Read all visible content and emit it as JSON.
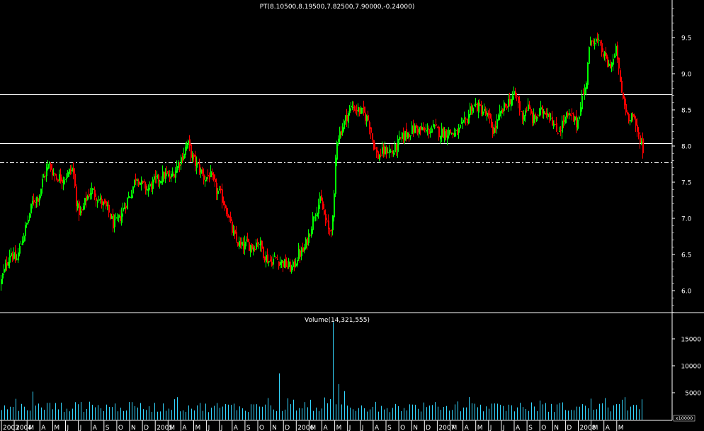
{
  "price_panel": {
    "title": "PT(8.10500,8.19500,7.82500,7.90000,-0.24000)"
  },
  "volume_panel": {
    "title": "Volume(14,321,555)",
    "multiplier": "x10000"
  },
  "colors": {
    "background": "#000000",
    "up_candle": "#00ff00",
    "down_candle": "#ff0000",
    "volume_bar": "#33d6ff",
    "grid_line": "#ffffff",
    "text": "#ffffff"
  },
  "chart_data": [
    {
      "type": "candlestick",
      "title": "PT(8.10500,8.19500,7.82500,7.90000,-0.24000)",
      "ylim": [
        5.6,
        10.0
      ],
      "y_ticks": [
        "9.5",
        "9.0",
        "8.5",
        "8.0",
        "7.5",
        "7.0",
        "6.5",
        "6.0"
      ],
      "horizontal_lines": [
        {
          "value": 8.72,
          "style": "solid"
        },
        {
          "value": 8.04,
          "style": "solid"
        },
        {
          "value": 7.77,
          "style": "dash-dot"
        }
      ],
      "last": {
        "open": 8.105,
        "high": 8.195,
        "low": 7.825,
        "close": 7.9,
        "change": -0.24
      },
      "price_path": [
        [
          0,
          6.1
        ],
        [
          6,
          6.3
        ],
        [
          14,
          6.55
        ],
        [
          22,
          6.4
        ],
        [
          30,
          6.7
        ],
        [
          38,
          6.95
        ],
        [
          46,
          7.25
        ],
        [
          54,
          7.3
        ],
        [
          60,
          7.55
        ],
        [
          68,
          7.75
        ],
        [
          76,
          7.6
        ],
        [
          86,
          7.55
        ],
        [
          94,
          7.6
        ],
        [
          102,
          7.7
        ],
        [
          108,
          7.15
        ],
        [
          114,
          7.05
        ],
        [
          120,
          7.25
        ],
        [
          128,
          7.4
        ],
        [
          136,
          7.3
        ],
        [
          144,
          7.2
        ],
        [
          152,
          7.1
        ],
        [
          160,
          6.9
        ],
        [
          168,
          7.0
        ],
        [
          176,
          7.2
        ],
        [
          184,
          7.35
        ],
        [
          192,
          7.6
        ],
        [
          200,
          7.45
        ],
        [
          208,
          7.4
        ],
        [
          216,
          7.5
        ],
        [
          224,
          7.55
        ],
        [
          232,
          7.6
        ],
        [
          240,
          7.55
        ],
        [
          248,
          7.7
        ],
        [
          256,
          7.85
        ],
        [
          264,
          8.05
        ],
        [
          272,
          7.8
        ],
        [
          280,
          7.7
        ],
        [
          288,
          7.55
        ],
        [
          296,
          7.6
        ],
        [
          304,
          7.4
        ],
        [
          312,
          7.3
        ],
        [
          320,
          7.1
        ],
        [
          326,
          6.85
        ],
        [
          332,
          6.7
        ],
        [
          340,
          6.6
        ],
        [
          348,
          6.65
        ],
        [
          356,
          6.6
        ],
        [
          364,
          6.7
        ],
        [
          372,
          6.5
        ],
        [
          380,
          6.4
        ],
        [
          388,
          6.45
        ],
        [
          396,
          6.4
        ],
        [
          404,
          6.35
        ],
        [
          412,
          6.3
        ],
        [
          420,
          6.5
        ],
        [
          428,
          6.55
        ],
        [
          436,
          6.8
        ],
        [
          444,
          7.1
        ],
        [
          452,
          7.25
        ],
        [
          458,
          7.0
        ],
        [
          464,
          6.8
        ],
        [
          470,
          7.0
        ],
        [
          474,
          8.1
        ],
        [
          480,
          8.2
        ],
        [
          488,
          8.4
        ],
        [
          496,
          8.55
        ],
        [
          504,
          8.5
        ],
        [
          512,
          8.45
        ],
        [
          520,
          8.35
        ],
        [
          526,
          8.05
        ],
        [
          532,
          7.85
        ],
        [
          538,
          7.9
        ],
        [
          546,
          7.95
        ],
        [
          554,
          7.9
        ],
        [
          562,
          8.05
        ],
        [
          570,
          8.15
        ],
        [
          578,
          8.2
        ],
        [
          586,
          8.25
        ],
        [
          594,
          8.22
        ],
        [
          602,
          8.2
        ],
        [
          610,
          8.25
        ],
        [
          618,
          8.2
        ],
        [
          626,
          8.18
        ],
        [
          634,
          8.2
        ],
        [
          642,
          8.15
        ],
        [
          650,
          8.25
        ],
        [
          658,
          8.35
        ],
        [
          664,
          8.55
        ],
        [
          672,
          8.55
        ],
        [
          680,
          8.5
        ],
        [
          688,
          8.4
        ],
        [
          696,
          8.2
        ],
        [
          704,
          8.4
        ],
        [
          712,
          8.55
        ],
        [
          720,
          8.65
        ],
        [
          728,
          8.7
        ],
        [
          736,
          8.4
        ],
        [
          744,
          8.55
        ],
        [
          752,
          8.35
        ],
        [
          760,
          8.45
        ],
        [
          768,
          8.5
        ],
        [
          776,
          8.45
        ],
        [
          784,
          8.2
        ],
        [
          790,
          8.25
        ],
        [
          798,
          8.4
        ],
        [
          806,
          8.4
        ],
        [
          814,
          8.3
        ],
        [
          820,
          8.65
        ],
        [
          826,
          8.8
        ],
        [
          830,
          9.3
        ],
        [
          836,
          9.5
        ],
        [
          842,
          9.45
        ],
        [
          850,
          9.3
        ],
        [
          858,
          9.1
        ],
        [
          866,
          9.2
        ],
        [
          870,
          9.35
        ],
        [
          874,
          8.9
        ],
        [
          880,
          8.6
        ],
        [
          886,
          8.4
        ],
        [
          892,
          8.45
        ],
        [
          898,
          8.2
        ],
        [
          904,
          8.1
        ],
        [
          908,
          7.9
        ]
      ]
    },
    {
      "type": "bar",
      "title": "Volume(14,321,555)",
      "unit": "x10000",
      "ylim": [
        0,
        18500
      ],
      "y_ticks": [
        "15000",
        "10000",
        "5000"
      ],
      "spikes": [
        [
          46,
          5200
        ],
        [
          68,
          4900
        ],
        [
          96,
          11700
        ],
        [
          116,
          5800
        ],
        [
          246,
          3800
        ],
        [
          308,
          4600
        ],
        [
          372,
          4800
        ],
        [
          394,
          8600
        ],
        [
          470,
          18100
        ],
        [
          478,
          6600
        ],
        [
          486,
          5300
        ],
        [
          520,
          4500
        ],
        [
          604,
          3900
        ],
        [
          662,
          4200
        ],
        [
          684,
          14700
        ],
        [
          688,
          9600
        ],
        [
          692,
          6900
        ],
        [
          834,
          3900
        ],
        [
          852,
          3700
        ],
        [
          878,
          3700
        ]
      ]
    }
  ],
  "x_axis": {
    "labels": [
      "2003",
      "2004",
      "M",
      "A",
      "M",
      "J",
      "J",
      "A",
      "S",
      "O",
      "N",
      "D",
      "2005",
      "M",
      "A",
      "M",
      "J",
      "J",
      "A",
      "S",
      "O",
      "N",
      "D",
      "2006",
      "M",
      "A",
      "M",
      "J",
      "J",
      "A",
      "S",
      "O",
      "N",
      "D",
      "2007",
      "M",
      "A",
      "M",
      "J",
      "J",
      "A",
      "S",
      "O",
      "N",
      "D",
      "2008",
      "M",
      "A",
      "M"
    ]
  }
}
